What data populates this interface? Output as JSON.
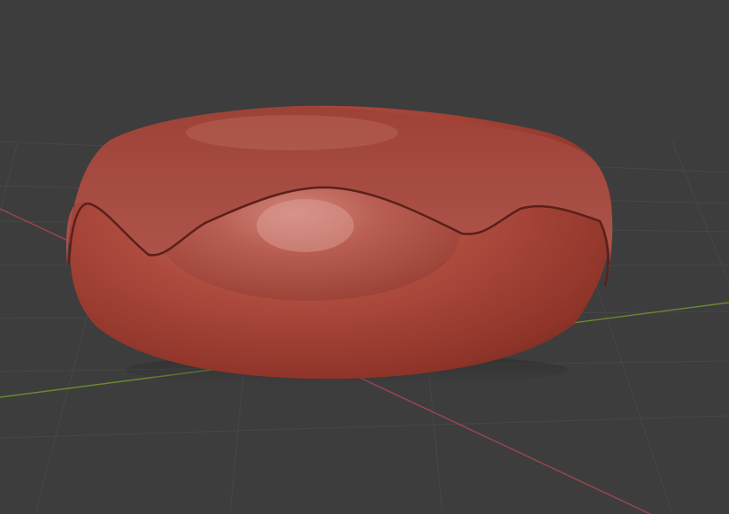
{
  "viewport": {
    "background": "#3d3d3d",
    "grid_line_color": "#4a4a4a",
    "x_axis_color": "#9c4650",
    "y_axis_color": "#6a8a2e"
  },
  "object": {
    "name": "donut",
    "base_color": "#a8443a",
    "highlight_color": "#d08478",
    "shadow_color": "#6a2a22"
  }
}
